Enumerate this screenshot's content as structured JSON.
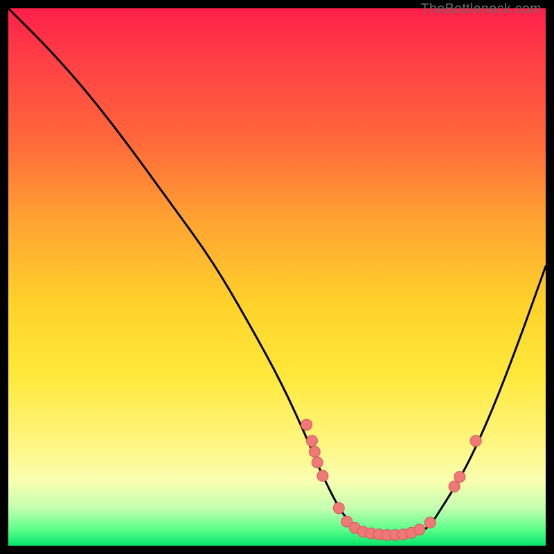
{
  "watermark": "TheBottleneck.com",
  "chart_data": {
    "type": "line",
    "title": "",
    "xlabel": "",
    "ylabel": "",
    "xlim": [
      0,
      100
    ],
    "ylim": [
      0,
      100
    ],
    "series": [
      {
        "name": "curve",
        "x": [
          0,
          8,
          15,
          22,
          30,
          38,
          45,
          51,
          56,
          58,
          62,
          65,
          70,
          74,
          78,
          80,
          85,
          90,
          95,
          100
        ],
        "values": [
          100,
          92,
          84,
          75,
          64,
          53,
          41,
          30,
          19,
          14,
          6,
          3,
          2,
          2,
          3,
          6,
          14,
          25,
          38,
          52
        ]
      }
    ],
    "markers": [
      {
        "x": 55.5,
        "y": 22.5
      },
      {
        "x": 56.5,
        "y": 19.5
      },
      {
        "x": 57.0,
        "y": 17.5
      },
      {
        "x": 57.5,
        "y": 15.5
      },
      {
        "x": 58.5,
        "y": 13.0
      },
      {
        "x": 61.5,
        "y": 7.0
      },
      {
        "x": 63.0,
        "y": 4.5
      },
      {
        "x": 64.5,
        "y": 3.3
      },
      {
        "x": 66.0,
        "y": 2.6
      },
      {
        "x": 67.5,
        "y": 2.3
      },
      {
        "x": 69.0,
        "y": 2.1
      },
      {
        "x": 70.5,
        "y": 2.0
      },
      {
        "x": 72.0,
        "y": 2.0
      },
      {
        "x": 73.5,
        "y": 2.1
      },
      {
        "x": 75.0,
        "y": 2.4
      },
      {
        "x": 76.5,
        "y": 3.0
      },
      {
        "x": 78.5,
        "y": 4.3
      },
      {
        "x": 83.0,
        "y": 11.0
      },
      {
        "x": 84.0,
        "y": 12.8
      },
      {
        "x": 87.0,
        "y": 19.5
      }
    ],
    "colors": {
      "curve": "#000000",
      "marker_fill": "#f07878",
      "marker_stroke": "#d05858"
    }
  }
}
